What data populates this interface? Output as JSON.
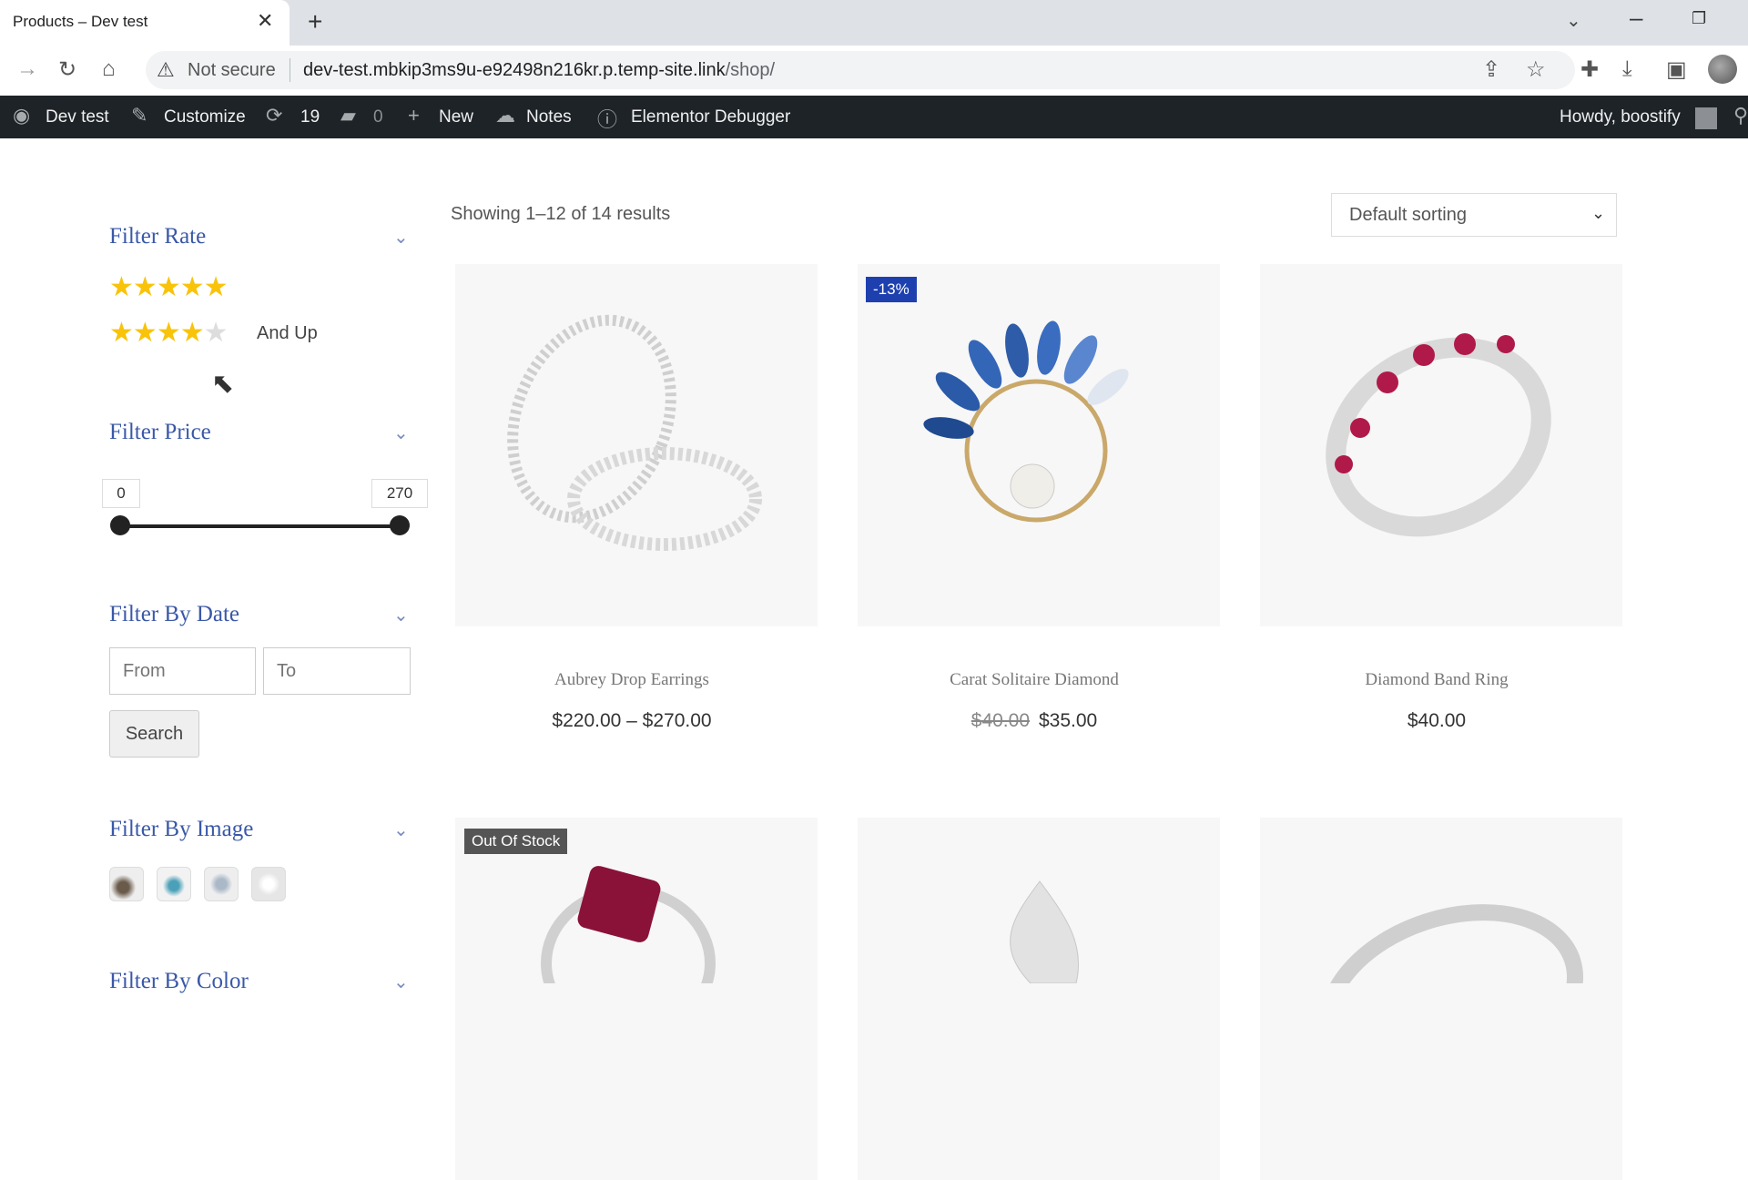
{
  "browser": {
    "tab_title": "Products – Dev test",
    "url_host": "dev-test.mbkip3ms9u-e92498n216kr.p.temp-site.link",
    "url_path": "/shop/",
    "security_label": "Not secure"
  },
  "admin_bar": {
    "site": "Dev test",
    "customize": "Customize",
    "updates": "19",
    "comments": "0",
    "new": "New",
    "notes": "Notes",
    "debugger": "Elementor Debugger",
    "howdy": "Howdy, boostify"
  },
  "sidebar": {
    "rate": {
      "title": "Filter Rate",
      "ratings": [
        5,
        4
      ],
      "and_up": "And Up"
    },
    "price": {
      "title": "Filter Price",
      "min": "0",
      "max": "270"
    },
    "date": {
      "title": "Filter By Date",
      "from_placeholder": "From",
      "to_placeholder": "To",
      "search_label": "Search"
    },
    "image": {
      "title": "Filter By Image"
    },
    "color": {
      "title": "Filter By Color"
    }
  },
  "shop": {
    "result_count": "Showing 1–12 of 14 results",
    "sort_label": "Default sorting",
    "products": [
      {
        "name": "Aubrey Drop Earrings",
        "price": "$220.00 – $270.00"
      },
      {
        "name": "Carat Solitaire Diamond",
        "old_price": "$40.00",
        "price": "$35.00",
        "badge": "-13%"
      },
      {
        "name": "Diamond Band Ring",
        "price": "$40.00"
      },
      {
        "badge": "Out Of Stock"
      }
    ]
  },
  "colors": {
    "admin_bar": "#1d2327",
    "filter_title": "#3a58a8",
    "star": "#f8c30a",
    "sale_badge": "#1e40af",
    "stock_badge": "#555555"
  }
}
